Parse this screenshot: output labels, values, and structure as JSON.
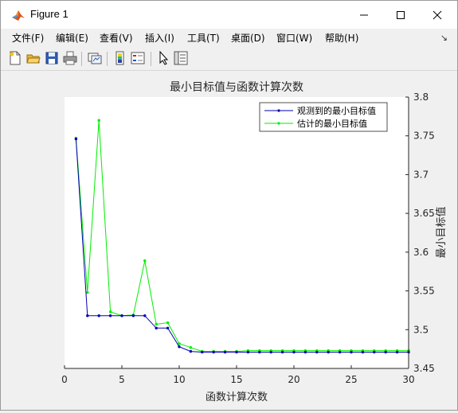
{
  "window": {
    "title": "Figure 1",
    "controls": {
      "minimize": "minimize",
      "maximize": "maximize",
      "close": "close"
    }
  },
  "menu": {
    "items": [
      "文件(F)",
      "编辑(E)",
      "查看(V)",
      "插入(I)",
      "工具(T)",
      "桌面(D)",
      "窗口(W)",
      "帮助(H)"
    ]
  },
  "toolbar": {
    "icons": [
      "new-figure-icon",
      "open-file-icon",
      "save-icon",
      "print-icon",
      "link-plot-icon",
      "insert-colorbar-icon",
      "insert-legend-icon",
      "edit-plot-icon",
      "property-inspector-icon"
    ]
  },
  "colors": {
    "observed": "#0000b4",
    "estimated": "#00ee00"
  },
  "chart_data": {
    "type": "line",
    "title": "最小目标值与函数计算次数",
    "xlabel": "函数计算次数",
    "ylabel": "最小目标值",
    "xlim": [
      0,
      30
    ],
    "ylim": [
      3.45,
      3.8
    ],
    "xticks": [
      "0",
      "5",
      "10",
      "15",
      "20",
      "25",
      "30"
    ],
    "yticks": [
      "3.45",
      "3.5",
      "3.55",
      "3.6",
      "3.65",
      "3.7",
      "3.75",
      "3.8"
    ],
    "y_axis_side": "right",
    "grid": false,
    "legend_position": "top-right",
    "x": [
      1,
      2,
      3,
      4,
      5,
      6,
      7,
      8,
      9,
      10,
      11,
      12,
      13,
      14,
      15,
      16,
      17,
      18,
      19,
      20,
      21,
      22,
      23,
      24,
      25,
      26,
      27,
      28,
      29,
      30
    ],
    "series": [
      {
        "name": "观测到的最小目标值",
        "values": [
          3.746,
          3.518,
          3.518,
          3.518,
          3.518,
          3.518,
          3.518,
          3.502,
          3.502,
          3.478,
          3.472,
          3.471,
          3.471,
          3.471,
          3.471,
          3.471,
          3.471,
          3.471,
          3.471,
          3.471,
          3.471,
          3.471,
          3.471,
          3.471,
          3.471,
          3.471,
          3.471,
          3.471,
          3.471,
          3.471
        ]
      },
      {
        "name": "估计的最小目标值",
        "values": [
          3.747,
          3.548,
          3.77,
          3.523,
          3.518,
          3.519,
          3.589,
          3.507,
          3.509,
          3.482,
          3.477,
          3.472,
          3.472,
          3.472,
          3.472,
          3.473,
          3.473,
          3.473,
          3.473,
          3.473,
          3.473,
          3.473,
          3.473,
          3.473,
          3.473,
          3.473,
          3.473,
          3.473,
          3.473,
          3.473
        ]
      }
    ]
  }
}
